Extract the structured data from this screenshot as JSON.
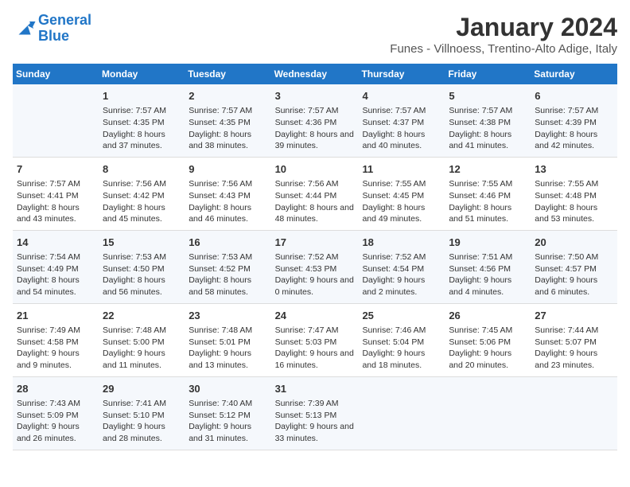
{
  "logo": {
    "line1": "General",
    "line2": "Blue"
  },
  "title": "January 2024",
  "location": "Funes - Villnoess, Trentino-Alto Adige, Italy",
  "days_of_week": [
    "Sunday",
    "Monday",
    "Tuesday",
    "Wednesday",
    "Thursday",
    "Friday",
    "Saturday"
  ],
  "weeks": [
    [
      {
        "day": "",
        "sunrise": "",
        "sunset": "",
        "daylight": ""
      },
      {
        "day": "1",
        "sunrise": "Sunrise: 7:57 AM",
        "sunset": "Sunset: 4:35 PM",
        "daylight": "Daylight: 8 hours and 37 minutes."
      },
      {
        "day": "2",
        "sunrise": "Sunrise: 7:57 AM",
        "sunset": "Sunset: 4:35 PM",
        "daylight": "Daylight: 8 hours and 38 minutes."
      },
      {
        "day": "3",
        "sunrise": "Sunrise: 7:57 AM",
        "sunset": "Sunset: 4:36 PM",
        "daylight": "Daylight: 8 hours and 39 minutes."
      },
      {
        "day": "4",
        "sunrise": "Sunrise: 7:57 AM",
        "sunset": "Sunset: 4:37 PM",
        "daylight": "Daylight: 8 hours and 40 minutes."
      },
      {
        "day": "5",
        "sunrise": "Sunrise: 7:57 AM",
        "sunset": "Sunset: 4:38 PM",
        "daylight": "Daylight: 8 hours and 41 minutes."
      },
      {
        "day": "6",
        "sunrise": "Sunrise: 7:57 AM",
        "sunset": "Sunset: 4:39 PM",
        "daylight": "Daylight: 8 hours and 42 minutes."
      }
    ],
    [
      {
        "day": "7",
        "sunrise": "Sunrise: 7:57 AM",
        "sunset": "Sunset: 4:41 PM",
        "daylight": "Daylight: 8 hours and 43 minutes."
      },
      {
        "day": "8",
        "sunrise": "Sunrise: 7:56 AM",
        "sunset": "Sunset: 4:42 PM",
        "daylight": "Daylight: 8 hours and 45 minutes."
      },
      {
        "day": "9",
        "sunrise": "Sunrise: 7:56 AM",
        "sunset": "Sunset: 4:43 PM",
        "daylight": "Daylight: 8 hours and 46 minutes."
      },
      {
        "day": "10",
        "sunrise": "Sunrise: 7:56 AM",
        "sunset": "Sunset: 4:44 PM",
        "daylight": "Daylight: 8 hours and 48 minutes."
      },
      {
        "day": "11",
        "sunrise": "Sunrise: 7:55 AM",
        "sunset": "Sunset: 4:45 PM",
        "daylight": "Daylight: 8 hours and 49 minutes."
      },
      {
        "day": "12",
        "sunrise": "Sunrise: 7:55 AM",
        "sunset": "Sunset: 4:46 PM",
        "daylight": "Daylight: 8 hours and 51 minutes."
      },
      {
        "day": "13",
        "sunrise": "Sunrise: 7:55 AM",
        "sunset": "Sunset: 4:48 PM",
        "daylight": "Daylight: 8 hours and 53 minutes."
      }
    ],
    [
      {
        "day": "14",
        "sunrise": "Sunrise: 7:54 AM",
        "sunset": "Sunset: 4:49 PM",
        "daylight": "Daylight: 8 hours and 54 minutes."
      },
      {
        "day": "15",
        "sunrise": "Sunrise: 7:53 AM",
        "sunset": "Sunset: 4:50 PM",
        "daylight": "Daylight: 8 hours and 56 minutes."
      },
      {
        "day": "16",
        "sunrise": "Sunrise: 7:53 AM",
        "sunset": "Sunset: 4:52 PM",
        "daylight": "Daylight: 8 hours and 58 minutes."
      },
      {
        "day": "17",
        "sunrise": "Sunrise: 7:52 AM",
        "sunset": "Sunset: 4:53 PM",
        "daylight": "Daylight: 9 hours and 0 minutes."
      },
      {
        "day": "18",
        "sunrise": "Sunrise: 7:52 AM",
        "sunset": "Sunset: 4:54 PM",
        "daylight": "Daylight: 9 hours and 2 minutes."
      },
      {
        "day": "19",
        "sunrise": "Sunrise: 7:51 AM",
        "sunset": "Sunset: 4:56 PM",
        "daylight": "Daylight: 9 hours and 4 minutes."
      },
      {
        "day": "20",
        "sunrise": "Sunrise: 7:50 AM",
        "sunset": "Sunset: 4:57 PM",
        "daylight": "Daylight: 9 hours and 6 minutes."
      }
    ],
    [
      {
        "day": "21",
        "sunrise": "Sunrise: 7:49 AM",
        "sunset": "Sunset: 4:58 PM",
        "daylight": "Daylight: 9 hours and 9 minutes."
      },
      {
        "day": "22",
        "sunrise": "Sunrise: 7:48 AM",
        "sunset": "Sunset: 5:00 PM",
        "daylight": "Daylight: 9 hours and 11 minutes."
      },
      {
        "day": "23",
        "sunrise": "Sunrise: 7:48 AM",
        "sunset": "Sunset: 5:01 PM",
        "daylight": "Daylight: 9 hours and 13 minutes."
      },
      {
        "day": "24",
        "sunrise": "Sunrise: 7:47 AM",
        "sunset": "Sunset: 5:03 PM",
        "daylight": "Daylight: 9 hours and 16 minutes."
      },
      {
        "day": "25",
        "sunrise": "Sunrise: 7:46 AM",
        "sunset": "Sunset: 5:04 PM",
        "daylight": "Daylight: 9 hours and 18 minutes."
      },
      {
        "day": "26",
        "sunrise": "Sunrise: 7:45 AM",
        "sunset": "Sunset: 5:06 PM",
        "daylight": "Daylight: 9 hours and 20 minutes."
      },
      {
        "day": "27",
        "sunrise": "Sunrise: 7:44 AM",
        "sunset": "Sunset: 5:07 PM",
        "daylight": "Daylight: 9 hours and 23 minutes."
      }
    ],
    [
      {
        "day": "28",
        "sunrise": "Sunrise: 7:43 AM",
        "sunset": "Sunset: 5:09 PM",
        "daylight": "Daylight: 9 hours and 26 minutes."
      },
      {
        "day": "29",
        "sunrise": "Sunrise: 7:41 AM",
        "sunset": "Sunset: 5:10 PM",
        "daylight": "Daylight: 9 hours and 28 minutes."
      },
      {
        "day": "30",
        "sunrise": "Sunrise: 7:40 AM",
        "sunset": "Sunset: 5:12 PM",
        "daylight": "Daylight: 9 hours and 31 minutes."
      },
      {
        "day": "31",
        "sunrise": "Sunrise: 7:39 AM",
        "sunset": "Sunset: 5:13 PM",
        "daylight": "Daylight: 9 hours and 33 minutes."
      },
      {
        "day": "",
        "sunrise": "",
        "sunset": "",
        "daylight": ""
      },
      {
        "day": "",
        "sunrise": "",
        "sunset": "",
        "daylight": ""
      },
      {
        "day": "",
        "sunrise": "",
        "sunset": "",
        "daylight": ""
      }
    ]
  ]
}
